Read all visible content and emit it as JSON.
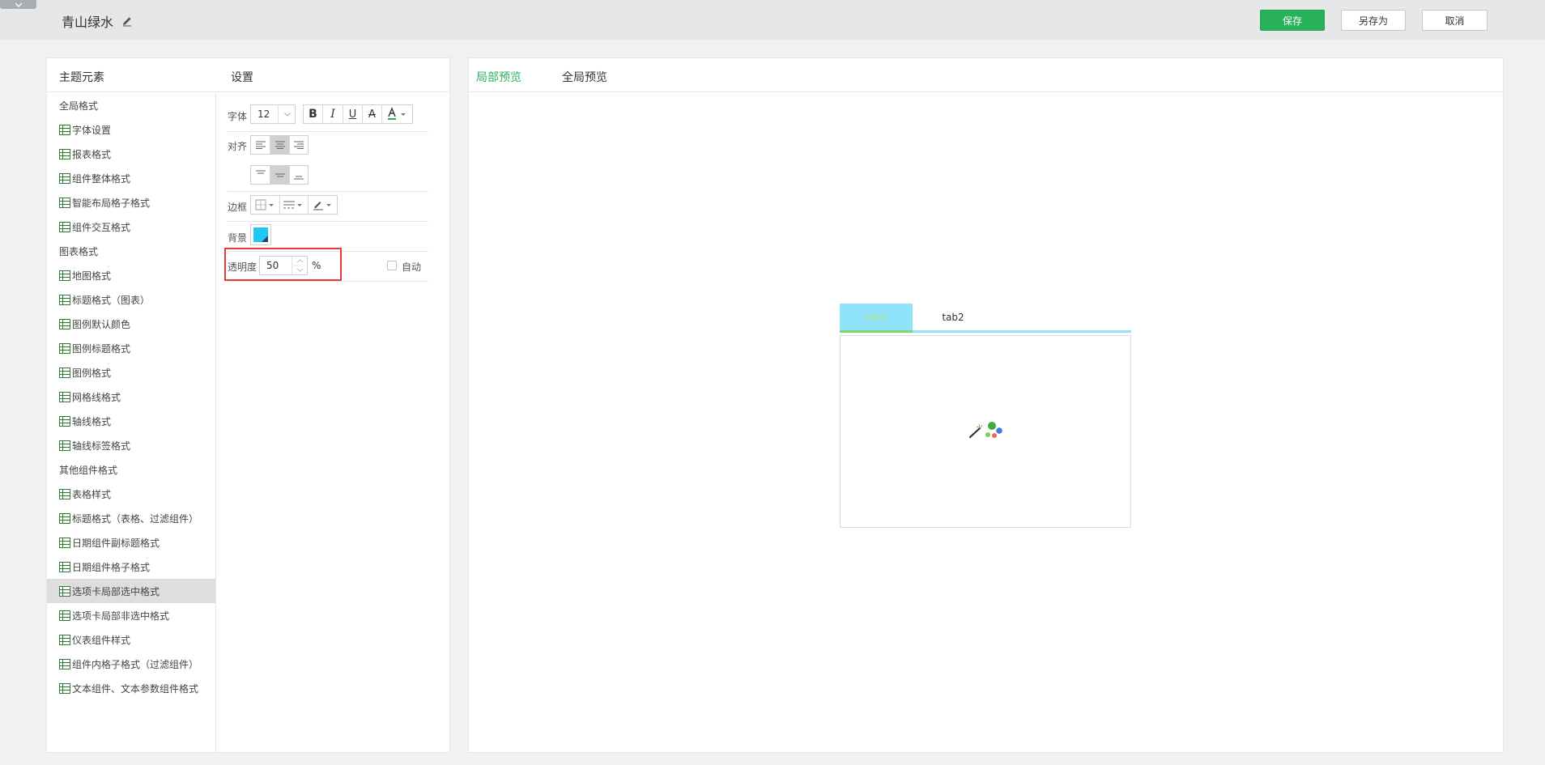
{
  "header": {
    "theme_name": "青山绿水",
    "save_label": "保存",
    "save_as_label": "另存为",
    "cancel_label": "取消"
  },
  "left_panel": {
    "elements_title": "主题元素",
    "settings_title": "设置"
  },
  "tree": [
    {
      "label": "全局格式",
      "type": "group"
    },
    {
      "label": "字体设置",
      "type": "item"
    },
    {
      "label": "报表格式",
      "type": "item"
    },
    {
      "label": "组件整体格式",
      "type": "item"
    },
    {
      "label": "智能布局格子格式",
      "type": "item"
    },
    {
      "label": "组件交互格式",
      "type": "item"
    },
    {
      "label": "图表格式",
      "type": "group"
    },
    {
      "label": "地图格式",
      "type": "item"
    },
    {
      "label": "标题格式（图表）",
      "type": "item"
    },
    {
      "label": "图例默认颜色",
      "type": "item"
    },
    {
      "label": "图例标题格式",
      "type": "item"
    },
    {
      "label": "图例格式",
      "type": "item"
    },
    {
      "label": "网格线格式",
      "type": "item"
    },
    {
      "label": "轴线格式",
      "type": "item"
    },
    {
      "label": "轴线标签格式",
      "type": "item"
    },
    {
      "label": "其他组件格式",
      "type": "group"
    },
    {
      "label": "表格样式",
      "type": "item"
    },
    {
      "label": "标题格式（表格、过滤组件）",
      "type": "item"
    },
    {
      "label": "日期组件副标题格式",
      "type": "item"
    },
    {
      "label": "日期组件格子格式",
      "type": "item"
    },
    {
      "label": "选项卡局部选中格式",
      "type": "item",
      "selected": true
    },
    {
      "label": "选项卡局部非选中格式",
      "type": "item"
    },
    {
      "label": "仪表组件样式",
      "type": "item"
    },
    {
      "label": "组件内格子格式（过滤组件）",
      "type": "item"
    },
    {
      "label": "文本组件、文本参数组件格式",
      "type": "item"
    }
  ],
  "settings": {
    "font_label": "字体",
    "font_size": "12",
    "align_label": "对齐",
    "border_label": "边框",
    "background_label": "背景",
    "background_color": "#1ec8f0",
    "opacity_label": "透明度",
    "opacity_value": "50",
    "opacity_unit": "%",
    "auto_label": "自动",
    "text_color_swatch": "#29b05a"
  },
  "preview": {
    "tab_local": "局部预览",
    "tab_global": "全局预览",
    "sample_tab1": "tab1",
    "sample_tab2": "tab2",
    "icons": {
      "loader": "magic-wand-icon"
    }
  },
  "colors": {
    "accent": "#29b05a",
    "tab_active_bg": "#8fe3fb",
    "highlight": "#e53935"
  }
}
